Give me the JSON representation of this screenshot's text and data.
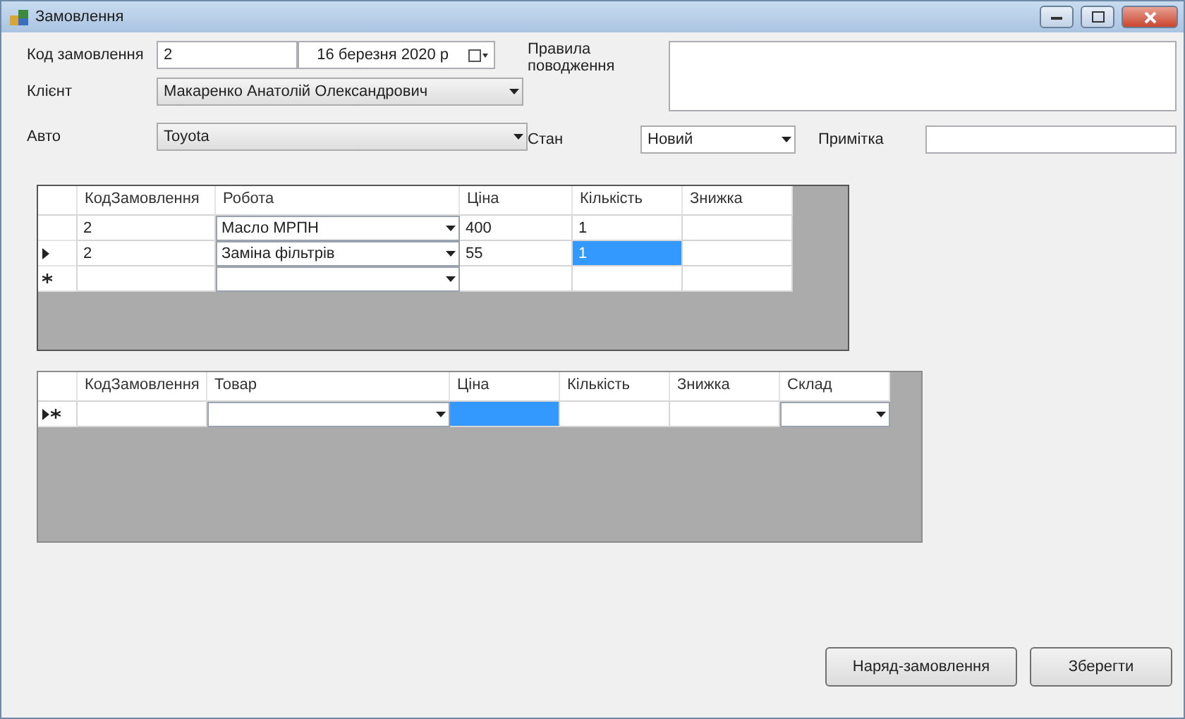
{
  "window": {
    "title": "Замовлення"
  },
  "order_code": {
    "label": "Код замовлення",
    "value": "2"
  },
  "date_picker": {
    "value": "16 березня 2020 р"
  },
  "rules": {
    "label": "Правила поводження"
  },
  "client": {
    "label": "Клієнт",
    "value": "Макаренко Анатолій Олександрович"
  },
  "car": {
    "label": "Авто",
    "value": "Toyota"
  },
  "status": {
    "label": "Стан",
    "value": "Новий"
  },
  "note": {
    "label": "Примітка"
  },
  "works_grid": {
    "columns": [
      {
        "label": "КодЗамовлення",
        "kind": "text"
      },
      {
        "label": "Робота",
        "kind": "combo"
      },
      {
        "label": "Ціна",
        "kind": "text"
      },
      {
        "label": "Кількість",
        "kind": "text"
      },
      {
        "label": "Знижка",
        "kind": "text"
      }
    ],
    "rows": [
      {
        "current": false,
        "new": false,
        "cells": [
          {
            "value": "2",
            "selected": false
          },
          {
            "value": "Масло МРПН",
            "selected": false
          },
          {
            "value": "400",
            "selected": false
          },
          {
            "value": "1",
            "selected": false
          },
          {
            "selected": false
          }
        ]
      },
      {
        "current": true,
        "new": false,
        "cells": [
          {
            "value": "2",
            "selected": false
          },
          {
            "value": "Заміна фільтрів",
            "selected": false
          },
          {
            "value": "55",
            "selected": false
          },
          {
            "value": "1",
            "selected": true
          },
          {
            "selected": false
          }
        ]
      },
      {
        "current": false,
        "new": true,
        "cells": [
          {
            "selected": false
          },
          {
            "selected": false
          },
          {
            "selected": false
          },
          {
            "selected": false
          },
          {
            "selected": false
          }
        ]
      }
    ]
  },
  "goods_grid": {
    "columns": [
      {
        "label": "КодЗамовлення",
        "kind": "text"
      },
      {
        "label": "Товар",
        "kind": "combo"
      },
      {
        "label": "Ціна",
        "kind": "text"
      },
      {
        "label": "Кількість",
        "kind": "text"
      },
      {
        "label": "Знижка",
        "kind": "text"
      },
      {
        "label": "Склад",
        "kind": "combo"
      }
    ],
    "rows": [
      {
        "current": true,
        "new": true,
        "cells": [
          {
            "selected": false
          },
          {
            "selected": false
          },
          {
            "selected": true
          },
          {
            "selected": false
          },
          {
            "selected": false
          },
          {
            "selected": false
          }
        ]
      }
    ]
  },
  "buttons": [
    {
      "label": "Наряд-замовлення"
    },
    {
      "label": "Зберегти"
    }
  ]
}
